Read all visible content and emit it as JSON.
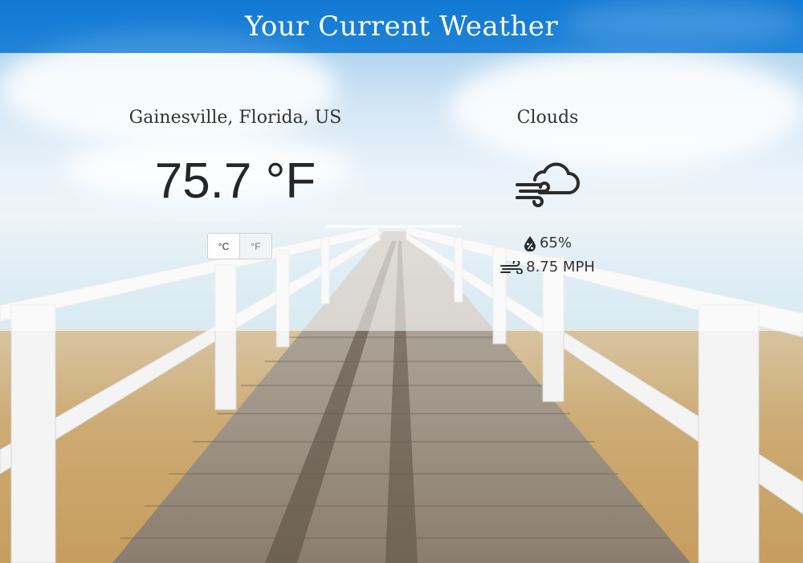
{
  "header": {
    "title": "Your Current Weather"
  },
  "location": {
    "name": "Gainesville, Florida, US"
  },
  "current": {
    "temperature": "75.7 °F",
    "condition": "Clouds",
    "humidity": "65%",
    "wind": "8.75 MPH"
  },
  "units": {
    "celsius_label": "°C",
    "fahrenheit_label": "°F"
  },
  "icons": {
    "weather": "cloud-wind-icon",
    "humidity": "humidity-drop-icon",
    "wind": "wind-icon"
  },
  "colors": {
    "header_bg": "#107ad6",
    "text": "#333333"
  }
}
